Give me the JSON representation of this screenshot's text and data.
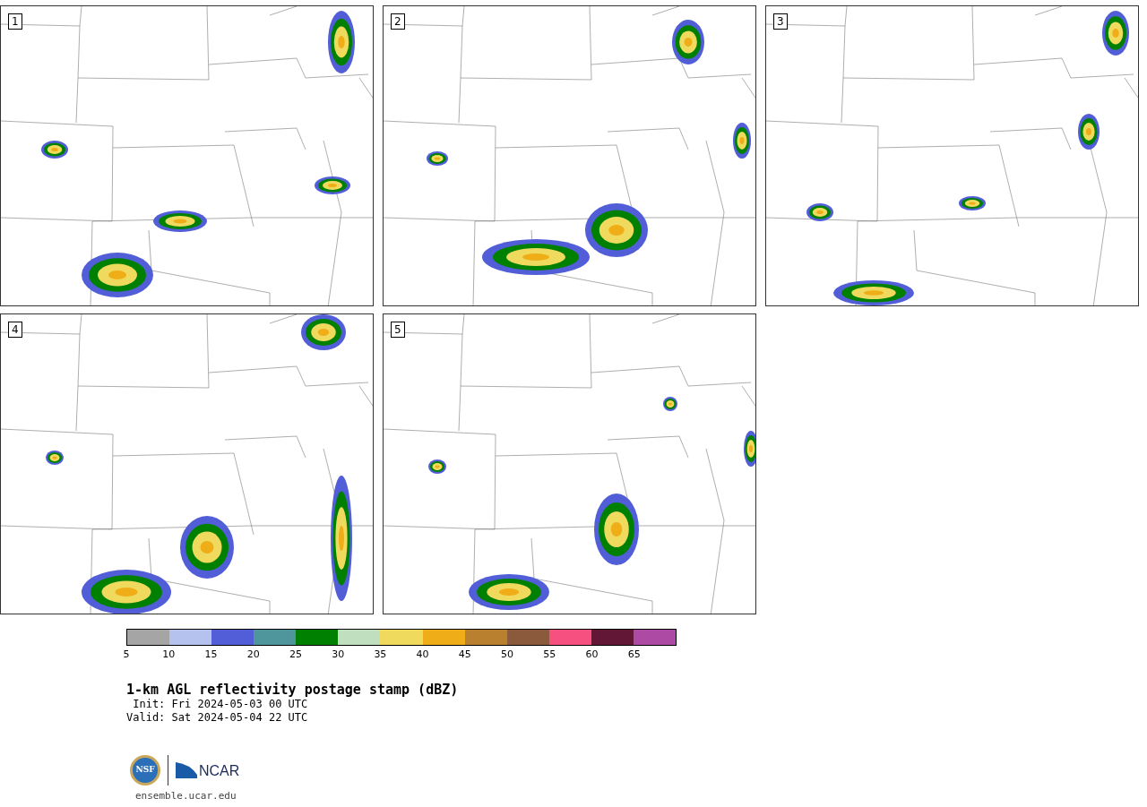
{
  "panels": [
    {
      "label": "1"
    },
    {
      "label": "2"
    },
    {
      "label": "3"
    },
    {
      "label": "4"
    },
    {
      "label": "5"
    }
  ],
  "colorbar": {
    "bins": [
      {
        "color": "#a5a5a5"
      },
      {
        "color": "#b6c2ee"
      },
      {
        "color": "#525ed8"
      },
      {
        "color": "#4e969c"
      },
      {
        "color": "#008000"
      },
      {
        "color": "#bfdfbf"
      },
      {
        "color": "#f0da5e"
      },
      {
        "color": "#efad18"
      },
      {
        "color": "#b9812f"
      },
      {
        "color": "#8b5a3c"
      },
      {
        "color": "#f65080"
      },
      {
        "color": "#621737"
      },
      {
        "color": "#ad4aa3"
      }
    ],
    "ticks": [
      "5",
      "10",
      "15",
      "20",
      "25",
      "30",
      "35",
      "40",
      "45",
      "50",
      "55",
      "60",
      "65"
    ]
  },
  "title": "1-km AGL reflectivity postage stamp (dBZ)",
  "init": " Init: Fri 2024-05-03 00 UTC",
  "valid": "Valid: Sat 2024-05-04 22 UTC",
  "logos": {
    "nsf": "NSF",
    "ncar": "NCAR"
  },
  "url": "ensemble.ucar.edu"
}
